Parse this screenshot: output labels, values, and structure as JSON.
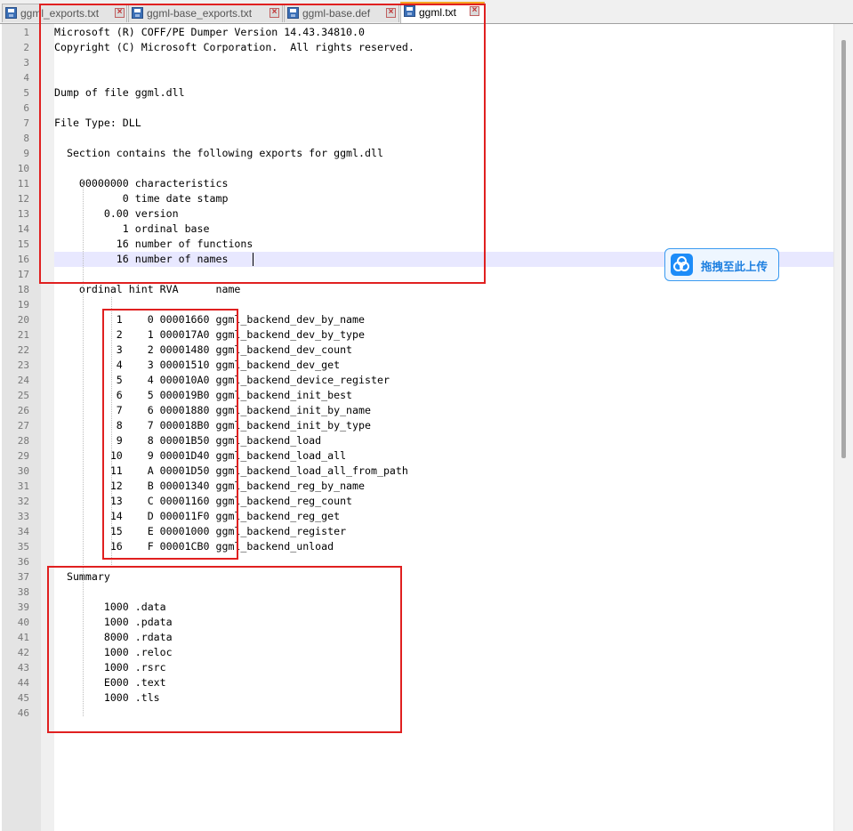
{
  "tabs": [
    {
      "label": "ggml_exports.txt",
      "active": false
    },
    {
      "label": "ggml-base_exports.txt",
      "active": false
    },
    {
      "label": "ggml-base.def",
      "active": false
    },
    {
      "label": "ggml.txt",
      "active": true
    }
  ],
  "close_glyph": "×",
  "upload_button": {
    "label": "拖拽至此上传"
  },
  "lines": [
    {
      "n": "1",
      "text": "Microsoft (R) COFF/PE Dumper Version 14.43.34810.0"
    },
    {
      "n": "2",
      "text": "Copyright (C) Microsoft Corporation.  All rights reserved."
    },
    {
      "n": "3",
      "text": ""
    },
    {
      "n": "4",
      "text": ""
    },
    {
      "n": "5",
      "text": "Dump of file ggml.dll"
    },
    {
      "n": "6",
      "text": ""
    },
    {
      "n": "7",
      "text": "File Type: DLL"
    },
    {
      "n": "8",
      "text": ""
    },
    {
      "n": "9",
      "text": "  Section contains the following exports for ggml.dll"
    },
    {
      "n": "10",
      "text": ""
    },
    {
      "n": "11",
      "text": "    00000000 characteristics"
    },
    {
      "n": "12",
      "text": "           0 time date stamp"
    },
    {
      "n": "13",
      "text": "        0.00 version"
    },
    {
      "n": "14",
      "text": "           1 ordinal base"
    },
    {
      "n": "15",
      "text": "          16 number of functions"
    },
    {
      "n": "16",
      "text": "          16 number of names"
    },
    {
      "n": "17",
      "text": ""
    },
    {
      "n": "18",
      "text": "    ordinal hint RVA      name"
    },
    {
      "n": "19",
      "text": ""
    },
    {
      "n": "20",
      "text": "          1    0 00001660 ggml_backend_dev_by_name"
    },
    {
      "n": "21",
      "text": "          2    1 000017A0 ggml_backend_dev_by_type"
    },
    {
      "n": "22",
      "text": "          3    2 00001480 ggml_backend_dev_count"
    },
    {
      "n": "23",
      "text": "          4    3 00001510 ggml_backend_dev_get"
    },
    {
      "n": "24",
      "text": "          5    4 000010A0 ggml_backend_device_register"
    },
    {
      "n": "25",
      "text": "          6    5 000019B0 ggml_backend_init_best"
    },
    {
      "n": "26",
      "text": "          7    6 00001880 ggml_backend_init_by_name"
    },
    {
      "n": "27",
      "text": "          8    7 000018B0 ggml_backend_init_by_type"
    },
    {
      "n": "28",
      "text": "          9    8 00001B50 ggml_backend_load"
    },
    {
      "n": "29",
      "text": "         10    9 00001D40 ggml_backend_load_all"
    },
    {
      "n": "30",
      "text": "         11    A 00001D50 ggml_backend_load_all_from_path"
    },
    {
      "n": "31",
      "text": "         12    B 00001340 ggml_backend_reg_by_name"
    },
    {
      "n": "32",
      "text": "         13    C 00001160 ggml_backend_reg_count"
    },
    {
      "n": "33",
      "text": "         14    D 000011F0 ggml_backend_reg_get"
    },
    {
      "n": "34",
      "text": "         15    E 00001000 ggml_backend_register"
    },
    {
      "n": "35",
      "text": "         16    F 00001CB0 ggml_backend_unload"
    },
    {
      "n": "36",
      "text": ""
    },
    {
      "n": "37",
      "text": "  Summary"
    },
    {
      "n": "38",
      "text": ""
    },
    {
      "n": "39",
      "text": "        1000 .data"
    },
    {
      "n": "40",
      "text": "        1000 .pdata"
    },
    {
      "n": "41",
      "text": "        8000 .rdata"
    },
    {
      "n": "42",
      "text": "        1000 .reloc"
    },
    {
      "n": "43",
      "text": "        1000 .rsrc"
    },
    {
      "n": "44",
      "text": "        E000 .text"
    },
    {
      "n": "45",
      "text": "        1000 .tls"
    },
    {
      "n": "46",
      "text": ""
    }
  ]
}
